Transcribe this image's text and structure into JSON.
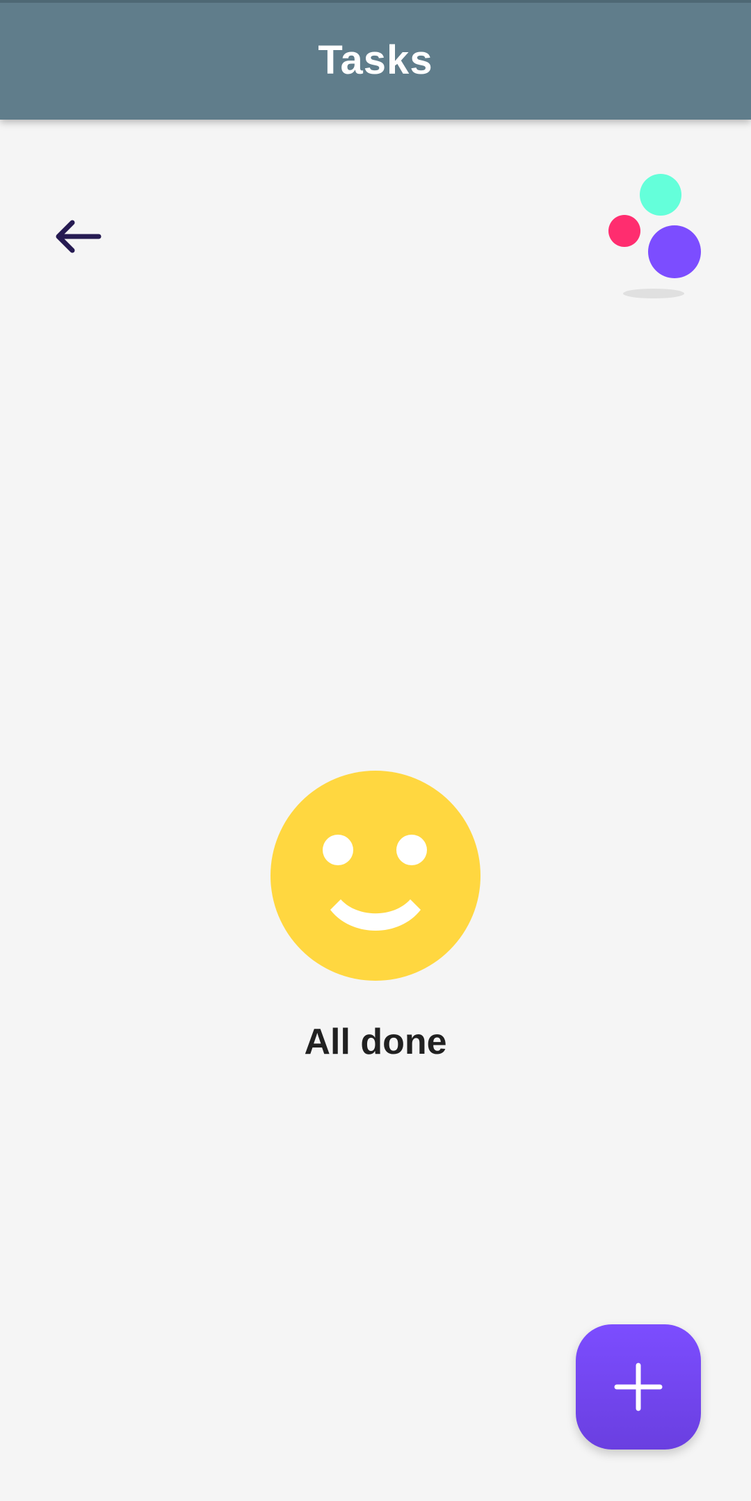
{
  "header": {
    "title": "Tasks"
  },
  "navigation": {
    "back_icon": "arrow-left-icon"
  },
  "logo": {
    "icon": "app-logo-dots",
    "colors": [
      "#64ffda",
      "#ff2d6f",
      "#7c4dff"
    ]
  },
  "empty_state": {
    "icon": "smiley-face-icon",
    "message": "All done"
  },
  "fab": {
    "icon": "plus-icon"
  },
  "colors": {
    "app_bar": "#607d8b",
    "background": "#f5f5f5",
    "accent": "#7c4dff",
    "smiley": "#ffd740"
  }
}
